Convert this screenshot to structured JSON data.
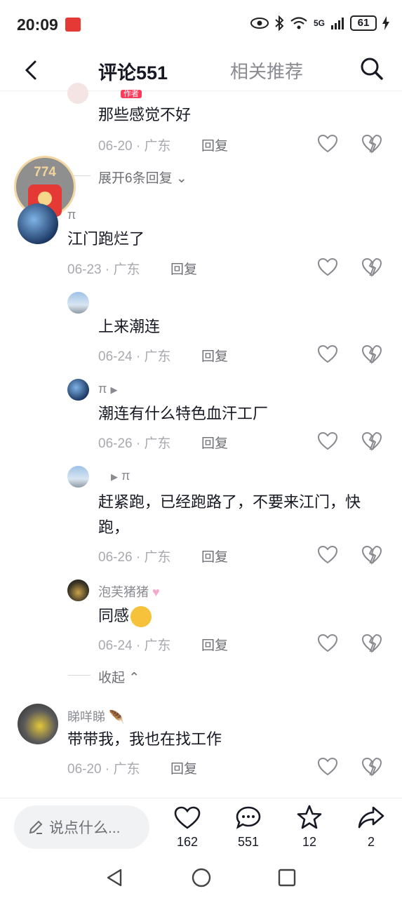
{
  "status_bar": {
    "time": "20:09",
    "battery": "61",
    "network": "5G"
  },
  "header": {
    "tab_comments": "评论551",
    "tab_related": "相关推荐"
  },
  "floating_counter": "774",
  "comments": [
    {
      "id": "c0",
      "text": "那些感觉不好",
      "date": "06-20",
      "location": "广东",
      "reply_label": "回复",
      "badge": "作者"
    },
    {
      "id": "c1",
      "name": "π",
      "text": "江门跑烂了",
      "date": "06-23",
      "location": "广东",
      "reply_label": "回复"
    },
    {
      "id": "c2",
      "name": "",
      "text": "上来潮连",
      "date": "06-24",
      "location": "广东",
      "reply_label": "回复"
    },
    {
      "id": "c3",
      "name": "π",
      "text": "潮连有什么特色血汗工厂",
      "date": "06-26",
      "location": "广东",
      "reply_label": "回复"
    },
    {
      "id": "c4",
      "name": "π",
      "text_line1": "赶紧跑，已经跑路了，不要来江门，快",
      "text_line2": "跑，",
      "date": "06-26",
      "location": "广东",
      "reply_label": "回复"
    },
    {
      "id": "c5",
      "name": "泡芙猪猪",
      "text": "同感",
      "date": "06-24",
      "location": "广东",
      "reply_label": "回复"
    },
    {
      "id": "c6",
      "name": "睇咩睇",
      "text": "带带我，我也在找工作",
      "date": "06-20",
      "location": "广东",
      "reply_label": "回复"
    }
  ],
  "expand_replies": "展开6条回复",
  "collapse_replies": "收起",
  "bottom": {
    "input_placeholder": "说点什么...",
    "likes": "162",
    "comments": "551",
    "favorites": "12",
    "shares": "2"
  },
  "colors": {
    "accent_red": "#ff3b5c",
    "text_primary": "#161823",
    "text_secondary": "#8a8b91"
  }
}
